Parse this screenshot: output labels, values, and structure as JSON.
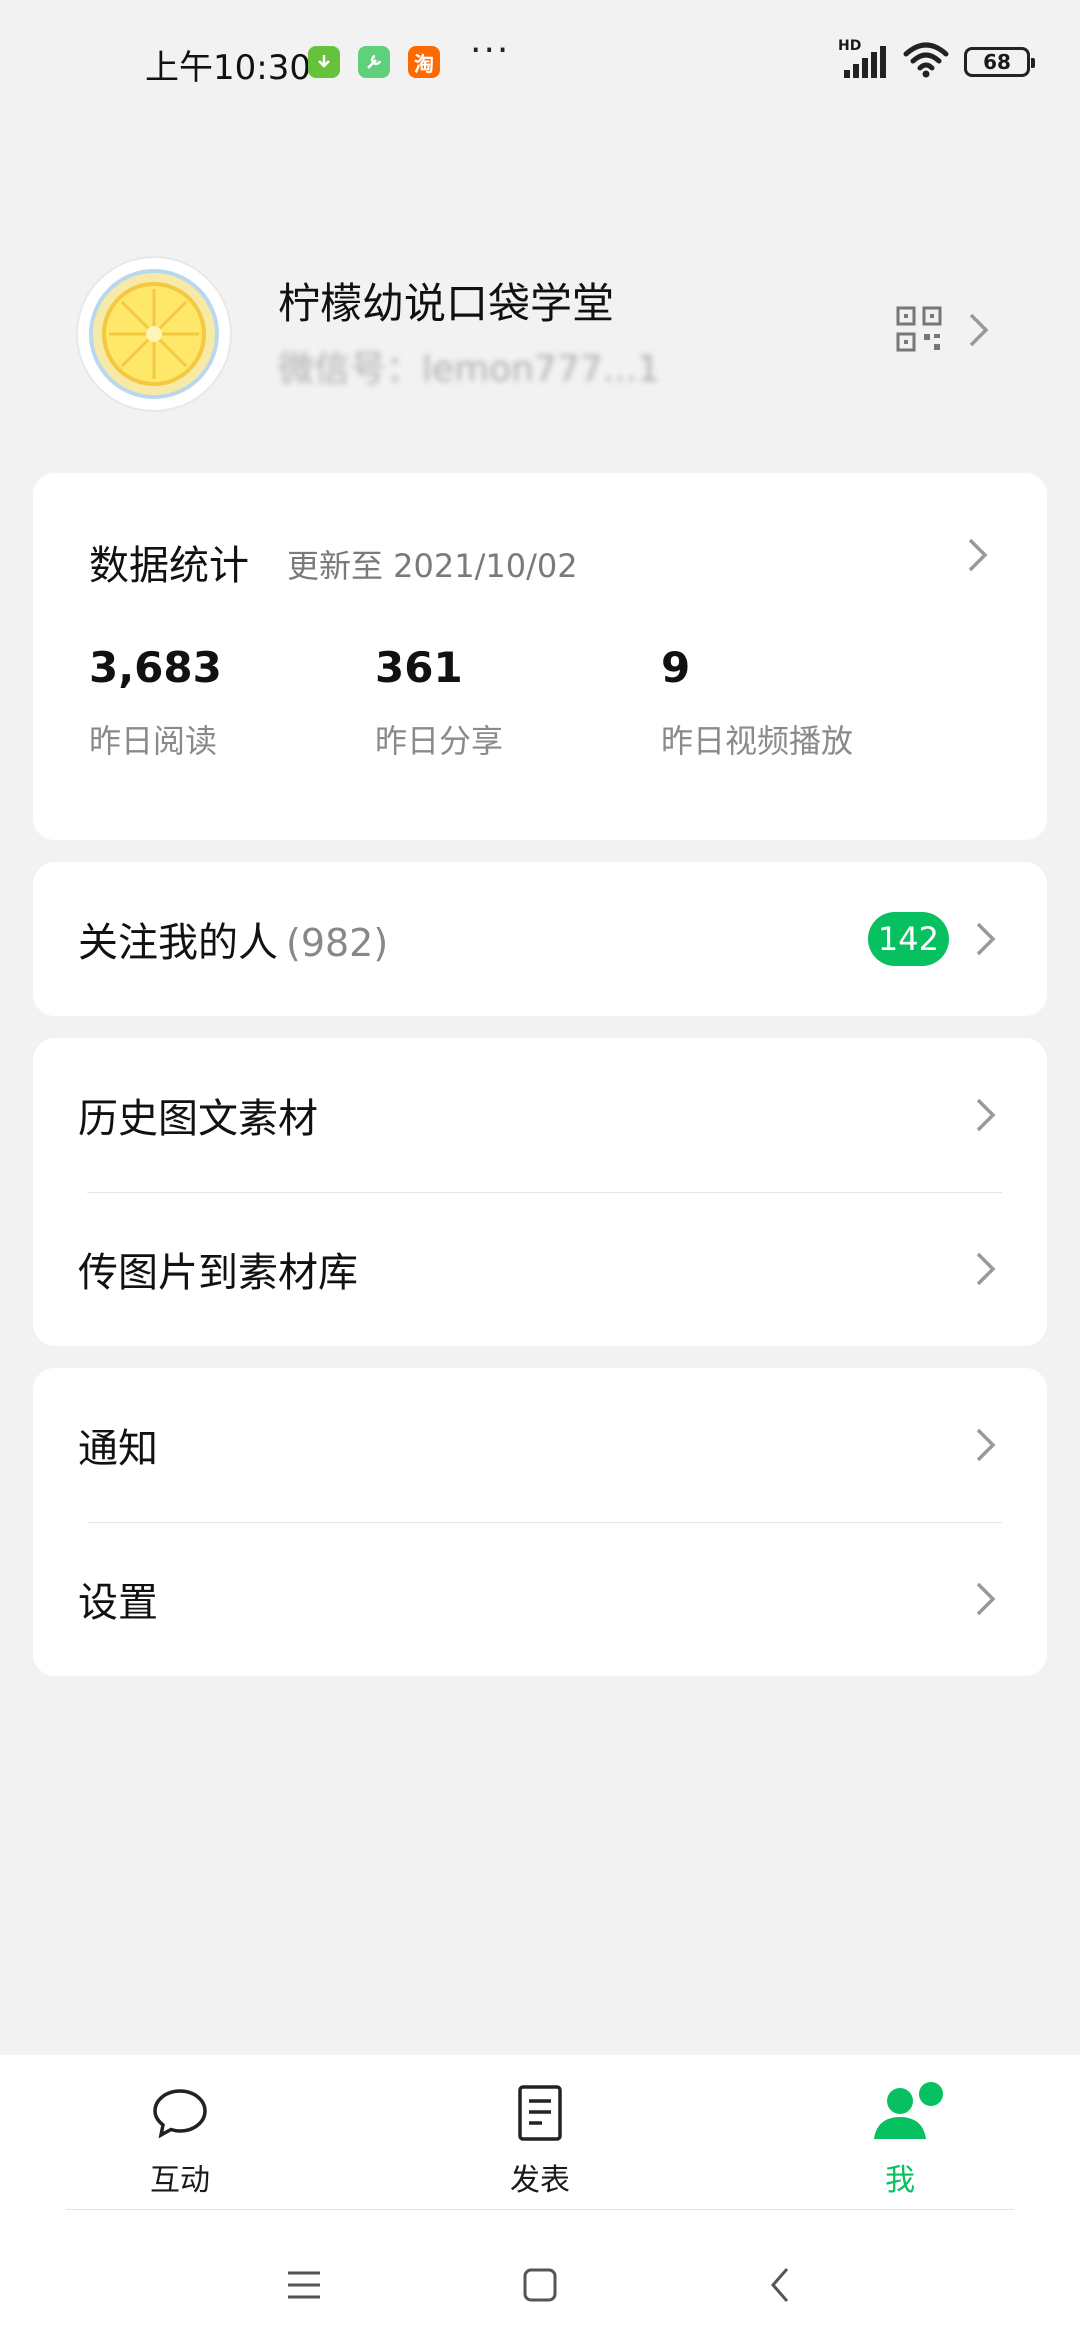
{
  "status_bar": {
    "time": "上午10:30",
    "more": "···",
    "network": "HD",
    "battery": "68",
    "app_icons": [
      "download-icon",
      "tool-icon",
      "taobao-icon"
    ],
    "taobao_char": "淘"
  },
  "profile": {
    "name": "柠檬幼说口袋学堂",
    "wechat_id": "微信号：lemon777...1"
  },
  "stats": {
    "title": "数据统计",
    "updated": "更新至 2021/10/02",
    "items": [
      {
        "value": "3,683",
        "label": "昨日阅读"
      },
      {
        "value": "361",
        "label": "昨日分享"
      },
      {
        "value": "9",
        "label": "昨日视频播放"
      }
    ]
  },
  "followers": {
    "label": "关注我的人",
    "count": "(982)",
    "badge": "142"
  },
  "materials": {
    "history": "历史图文素材",
    "upload": "传图片到素材库"
  },
  "settings_group": {
    "notify": "通知",
    "settings": "设置"
  },
  "tabs": [
    {
      "label": "互动",
      "icon": "chat-bubble-icon"
    },
    {
      "label": "发表",
      "icon": "document-icon"
    },
    {
      "label": "我",
      "icon": "person-icon",
      "active": true
    }
  ],
  "colors": {
    "accent": "#07c160",
    "background": "#f2f2f2"
  }
}
